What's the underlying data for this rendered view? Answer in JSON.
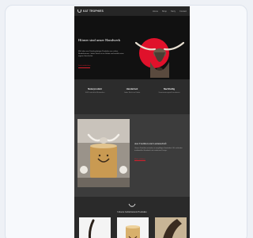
{
  "brand": {
    "name": "KAT TROPHIES"
  },
  "nav": {
    "links": [
      "Home",
      "Shop",
      "Story",
      "Contact"
    ]
  },
  "hero": {
    "title": "Hörner sind unser Handwerk",
    "subtitle": "Mit Liebe zum Detail gefertigte Produkte aus echten Rinderhörnern. Jedes Stück ist ein Unikat und erzählt seine eigene Geschichte.",
    "cta": "Jetzt entdecken"
  },
  "features": [
    {
      "title": "Naturprodukt",
      "text": "100% natürliche Materialien"
    },
    {
      "title": "Handarbeit",
      "text": "Jedes Stück ein Unikat"
    },
    {
      "title": "Nachhaltig",
      "text": "Verantwortungsvoll verarbeitet"
    }
  ],
  "story": {
    "title": "Aus Tradition und Leidenschaft",
    "text": "Unsere Produkte entstehen in sorgfältiger Handarbeit. Wir verbinden traditionelles Handwerk mit modernem Design.",
    "cta": "Mehr erfahren"
  },
  "products": {
    "title": "Unsere beliebtesten Produkte"
  },
  "colors": {
    "accent": "#d51f2b",
    "dark": "#2c2c2c"
  }
}
